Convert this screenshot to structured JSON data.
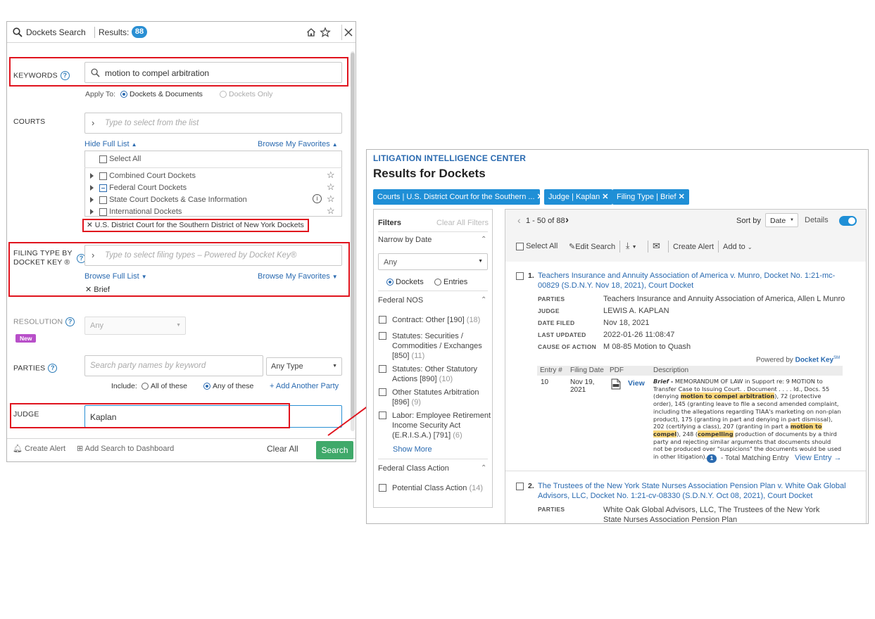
{
  "search_panel": {
    "title": "Dockets Search",
    "results_label": "Results:",
    "results_count": "88",
    "keywords": {
      "label": "KEYWORDS",
      "value": "motion to compel arbitration",
      "apply_to_label": "Apply To:",
      "option_1": "Dockets & Documents",
      "option_2": "Dockets Only"
    },
    "courts": {
      "label": "COURTS",
      "placeholder": "Type to select from the list",
      "hide_full_list": "Hide Full List",
      "browse_favorites": "Browse My Favorites",
      "select_all": "Select All",
      "items": [
        "Combined Court Dockets",
        "Federal Court Dockets",
        "State Court Dockets & Case Information",
        "International Dockets"
      ],
      "selected": "U.S. District Court for the Southern District of New York Dockets"
    },
    "filing_type": {
      "label_line1": "FILING TYPE BY",
      "label_line2": "DOCKET KEY ®",
      "placeholder": "Type to select filing types – Powered by Docket Key®",
      "browse_full_list": "Browse Full List",
      "browse_favorites": "Browse My Favorites",
      "selected": "Brief"
    },
    "resolution": {
      "label": "RESOLUTION",
      "new_badge": "New",
      "value": "Any"
    },
    "parties": {
      "label": "PARTIES",
      "placeholder": "Search party names by keyword",
      "type_value": "Any Type",
      "include_label": "Include:",
      "option_all": "All of these",
      "option_any": "Any of these",
      "add_party": "+ Add Another Party"
    },
    "judge": {
      "label": "JUDGE",
      "value": "Kaplan"
    },
    "footer": {
      "create_alert": "Create Alert",
      "add_dashboard": "Add Search to Dashboard",
      "clear_all": "Clear All",
      "search": "Search"
    }
  },
  "results_panel": {
    "app_name": "LITIGATION INTELLIGENCE CENTER",
    "title": "Results for Dockets",
    "chips": [
      "Courts | U.S. District Court for the Southern ...",
      "Judge | Kaplan",
      "Filing Type | Brief"
    ],
    "filters": {
      "title": "Filters",
      "clear": "Clear All Filters",
      "narrow_by_date": "Narrow by Date",
      "date_value": "Any",
      "radio_dockets": "Dockets",
      "radio_entries": "Entries",
      "federal_nos": "Federal NOS",
      "nos_items": [
        {
          "label": "Contract: Other [190]",
          "count": "(18)"
        },
        {
          "label": "Statutes: Securities / Commodities / Exchanges [850]",
          "count": "(11)"
        },
        {
          "label": "Statutes: Other Statutory Actions [890]",
          "count": "(10)"
        },
        {
          "label": "Other Statutes Arbitration [896]",
          "count": "(9)"
        },
        {
          "label": "Labor: Employee Retirement Income Security Act (E.R.I.S.A.) [791]",
          "count": "(6)"
        }
      ],
      "show_more": "Show More",
      "federal_class_action": "Federal Class Action",
      "class_action_item": "Potential Class Action",
      "class_action_count": "(14)"
    },
    "toolbar": {
      "range": "1 - 50 of 88",
      "sort_by": "Sort by",
      "sort_value": "Date",
      "details": "Details",
      "select_all": "Select All",
      "edit_search": "Edit Search",
      "create_alert": "Create Alert",
      "add_to": "Add to"
    },
    "results": [
      {
        "num": "1.",
        "title": "Teachers Insurance and Annuity Association of America v. Munro, Docket No. 1:21-mc-00829 (S.D.N.Y. Nov 18, 2021), Court Docket",
        "parties_label": "PARTIES",
        "parties": "Teachers Insurance and Annuity Association of America, Allen L Munro",
        "judge_label": "JUDGE",
        "judge": "LEWIS A. KAPLAN",
        "date_filed_label": "DATE FILED",
        "date_filed": "Nov 18, 2021",
        "last_updated_label": "LAST UPDATED",
        "last_updated": "2022-01-26 11:08:47",
        "cause_label": "CAUSE OF ACTION",
        "cause": "M 08-85 Motion to Quash",
        "powered_by": "Powered by",
        "docket_key": "Docket Key",
        "sm": "SM",
        "entry_headers": [
          "Entry #",
          "Filing Date",
          "PDF",
          "Description"
        ],
        "entry_num": "10",
        "entry_date": "Nov 19, 2021",
        "view": "View",
        "matching_count": "1",
        "matching_label": "- Total Matching Entry",
        "view_entry": "View Entry"
      },
      {
        "num": "2.",
        "title": "The Trustees of the New York State Nurses Association Pension Plan v. White Oak Global Advisors, LLC, Docket No. 1:21-cv-08330 (S.D.N.Y. Oct 08, 2021), Court Docket",
        "parties_label": "PARTIES",
        "parties": "White Oak Global Advisors, LLC, The Trustees of the New York State Nurses Association Pension Plan"
      }
    ]
  },
  "colors": {
    "accent": "#2a6ab0",
    "chip": "#1f8fd6",
    "search_button": "#3fa96a",
    "highlight_box": "#e0141e",
    "highlight_text": "#fcd879"
  }
}
